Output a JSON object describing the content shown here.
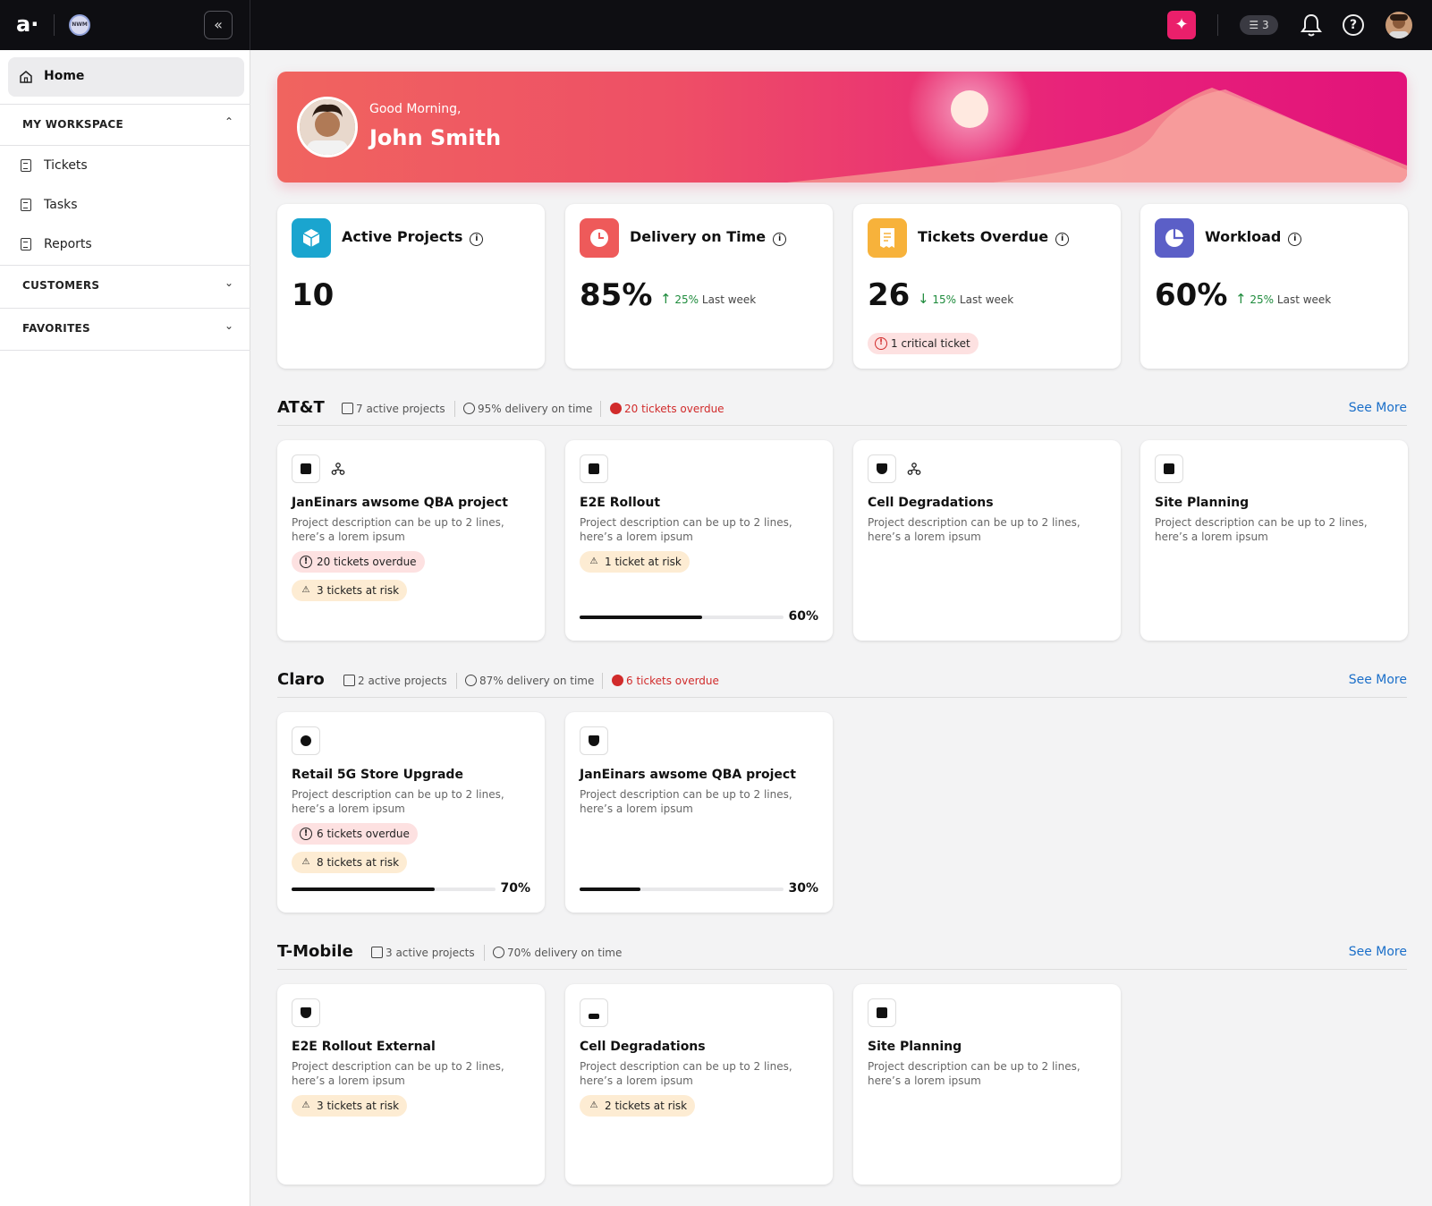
{
  "topbar": {
    "logo": "a·",
    "workspace_badge": "NWM",
    "collapse_icon": "«",
    "ai_icon": "✦",
    "tasks_count": "3",
    "help_icon": "?"
  },
  "sidebar": {
    "home": "Home",
    "my_workspace": "MY WORKSPACE",
    "items": [
      "Tickets",
      "Tasks",
      "Reports"
    ],
    "customers": "CUSTOMERS",
    "favorites": "FAVORITES"
  },
  "banner": {
    "greeting": "Good Morning,",
    "name": "John Smith"
  },
  "kpis": [
    {
      "title": "Active Projects",
      "value": "10",
      "icon": "cube-icon",
      "color": "#1aa5cf"
    },
    {
      "title": "Delivery on Time",
      "value": "85%",
      "delta": "25%",
      "delta_label": "Last week",
      "trend": "up",
      "icon": "clock-icon",
      "color": "#ee5a5a"
    },
    {
      "title": "Tickets Overdue",
      "value": "26",
      "delta": "15%",
      "delta_label": "Last week",
      "trend": "down",
      "critical": "1 critical ticket",
      "icon": "receipt-icon",
      "color": "#f7b23b"
    },
    {
      "title": "Workload",
      "value": "60%",
      "delta": "25%",
      "delta_label": "Last week",
      "trend": "up",
      "icon": "pie-icon",
      "color": "#5b5fc7"
    }
  ],
  "see_more": "See More",
  "customers": [
    {
      "name": "AT&T",
      "active": "7 active projects",
      "delivery": "95% delivery on time",
      "overdue": "20 tickets overdue",
      "projects": [
        {
          "title": "JanEinars awsome QBA project",
          "desc": "Project description can be up to 2 lines, here’s a lorem ipsum",
          "overdue": "20 tickets overdue",
          "risk": "3 tickets at risk"
        },
        {
          "title": "E2E Rollout",
          "desc": "Project description can be up to 2 lines, here’s a lorem ipsum",
          "risk": "1 ticket at risk",
          "progress": 0.6,
          "progress_label": "60%"
        },
        {
          "title": "Cell Degradations",
          "desc": "Project description can be up to 2 lines, here’s a lorem ipsum"
        },
        {
          "title": "Site Planning",
          "desc": "Project description can be up to 2 lines, here’s a lorem ipsum"
        }
      ]
    },
    {
      "name": "Claro",
      "active": "2 active projects",
      "delivery": "87% delivery on time",
      "overdue": "6 tickets overdue",
      "projects": [
        {
          "title": "Retail 5G Store Upgrade",
          "desc": "Project description can be up to  2 lines, here’s a lorem ipsum",
          "overdue": "6 tickets overdue",
          "risk": "8 tickets at risk",
          "progress": 0.7,
          "progress_label": "70%"
        },
        {
          "title": "JanEinars awsome QBA project",
          "desc": "Project description can be up to 2 lines, here’s a lorem ipsum",
          "progress": 0.3,
          "progress_label": "30%"
        }
      ]
    },
    {
      "name": "T-Mobile",
      "active": "3 active projects",
      "delivery": "70% delivery on time",
      "projects": [
        {
          "title": "E2E Rollout External",
          "desc": "Project description can be up to 2 lines, here’s a lorem ipsum",
          "risk": "3 tickets at risk"
        },
        {
          "title": "Cell Degradations",
          "desc": "Project description can be up to 2 lines, here’s a lorem ipsum",
          "risk": "2 tickets at risk"
        },
        {
          "title": "Site Planning",
          "desc": "Project description can be up to 2 lines, here’s a lorem ipsum"
        }
      ]
    }
  ]
}
